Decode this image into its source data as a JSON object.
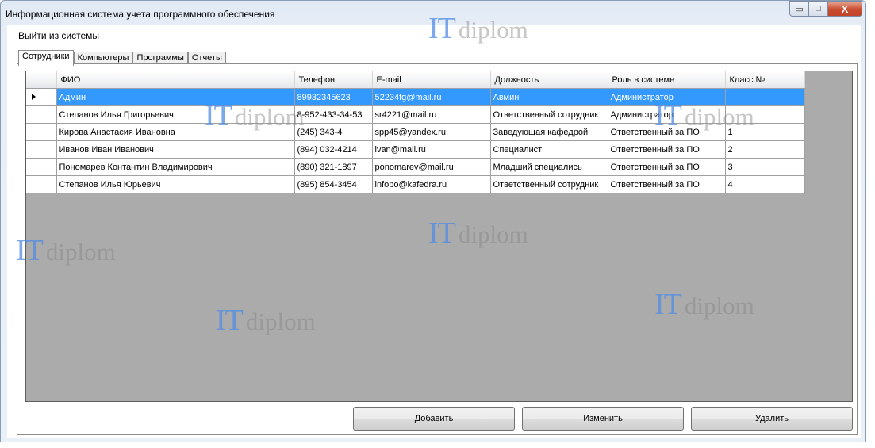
{
  "window": {
    "title": "Информационная система учета программного обеспечения",
    "minimize_glyph": "▭",
    "maximize_glyph": "□",
    "close_glyph": "X"
  },
  "menu": {
    "logout": "Выйти из системы"
  },
  "tabs": [
    {
      "label": "Сотрудники",
      "active": true
    },
    {
      "label": "Компьютеры",
      "active": false
    },
    {
      "label": "Программы",
      "active": false
    },
    {
      "label": "Отчеты",
      "active": false
    }
  ],
  "table": {
    "columns": [
      "ФИО",
      "Телефон",
      "E-mail",
      "Должность",
      "Роль в системе",
      "Класс №"
    ],
    "rows": [
      {
        "fio": "Админ",
        "phone": "89932345623",
        "email": "52234fg@mail.ru",
        "position": "Авмин",
        "role": "Администратор",
        "class": "",
        "selected": true
      },
      {
        "fio": "Степанов Илья Григорьевич",
        "phone": "8-952-433-34-53",
        "email": "sr4221@mail.ru",
        "position": "Ответственный сотрудник",
        "role": "Администратор",
        "class": ""
      },
      {
        "fio": "Кирова Анастасия Ивановна",
        "phone": "(245) 343-4",
        "email": "spp45@yandex.ru",
        "position": "Заведующая кафедрой",
        "role": "Ответственный за ПО",
        "class": "1"
      },
      {
        "fio": "Иванов Иван Иванович",
        "phone": "(894) 032-4214",
        "email": "ivan@mail.ru",
        "position": "Специалист",
        "role": "Ответственный за ПО",
        "class": "2"
      },
      {
        "fio": "Пономарев Контантин Владимирович",
        "phone": "(890) 321-1897",
        "email": "ponomarev@mail.ru",
        "position": "Младший специались",
        "role": "Ответственный за ПО",
        "class": "3"
      },
      {
        "fio": "Степанов Илья Юрьевич",
        "phone": "(895) 854-3454",
        "email": "infopo@kafedra.ru",
        "position": "Ответственный сотрудник",
        "role": "Ответственный за ПО",
        "class": "4"
      }
    ]
  },
  "buttons": {
    "add": "Добавить",
    "edit": "Изменить",
    "delete": "Удалить"
  },
  "watermark": {
    "it": "IT",
    "diplom": "diplom"
  },
  "colors": {
    "selection": "#3399ff",
    "grid_background": "#ababab",
    "close_button": "#c94b2e"
  }
}
